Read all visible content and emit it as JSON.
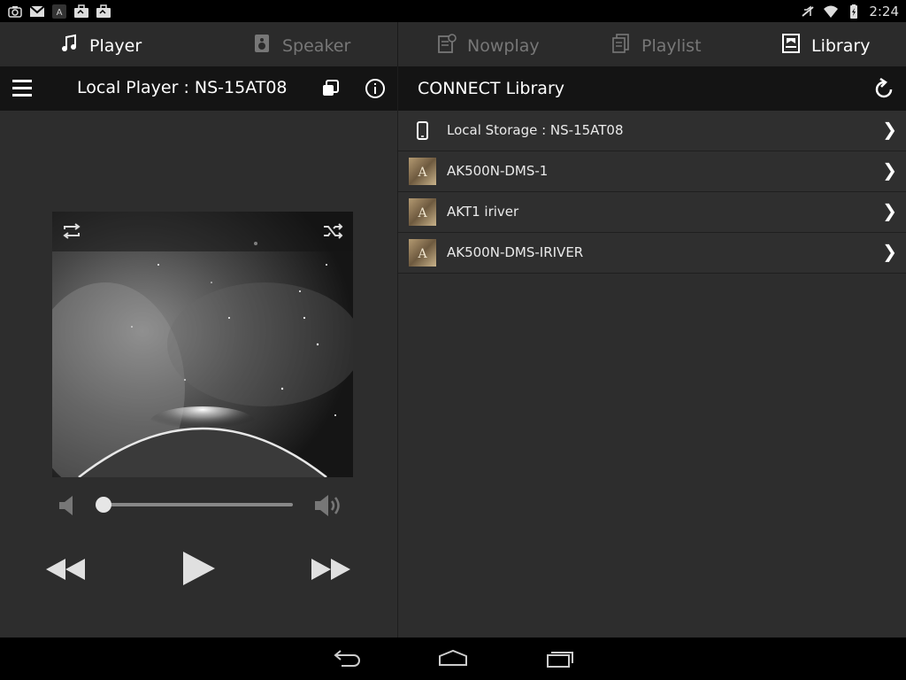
{
  "status_bar": {
    "time": "2:24",
    "left_icons": [
      "screenshot-icon",
      "gmail-icon",
      "app-a-icon",
      "briefcase-icon",
      "briefcase-icon"
    ],
    "right_icons": [
      "mute-icon",
      "wifi-icon",
      "battery-charging-icon"
    ]
  },
  "tabs": [
    {
      "label": "Player",
      "icon": "music-note-icon",
      "active": true
    },
    {
      "label": "Speaker",
      "icon": "speaker-icon",
      "active": false
    },
    {
      "label": "Nowplay",
      "icon": "nowplay-icon",
      "active": false
    },
    {
      "label": "Playlist",
      "icon": "playlist-icon",
      "active": false
    },
    {
      "label": "Library",
      "icon": "library-icon",
      "active": true
    }
  ],
  "player": {
    "title": "Local Player : NS-15AT08",
    "volume_level": 0.0
  },
  "library": {
    "title": "CONNECT Library",
    "items": [
      {
        "label": "Local Storage : NS-15AT08",
        "icon": "phone-icon"
      },
      {
        "label": "AK500N-DMS-1",
        "icon": "server-thumb-icon"
      },
      {
        "label": "AKT1 iriver",
        "icon": "server-thumb-icon"
      },
      {
        "label": "AK500N-DMS-IRIVER",
        "icon": "server-thumb-icon"
      }
    ]
  },
  "colors": {
    "background": "#2d2d2d",
    "header": "#141414",
    "tabbar": "#2b2b2b"
  }
}
